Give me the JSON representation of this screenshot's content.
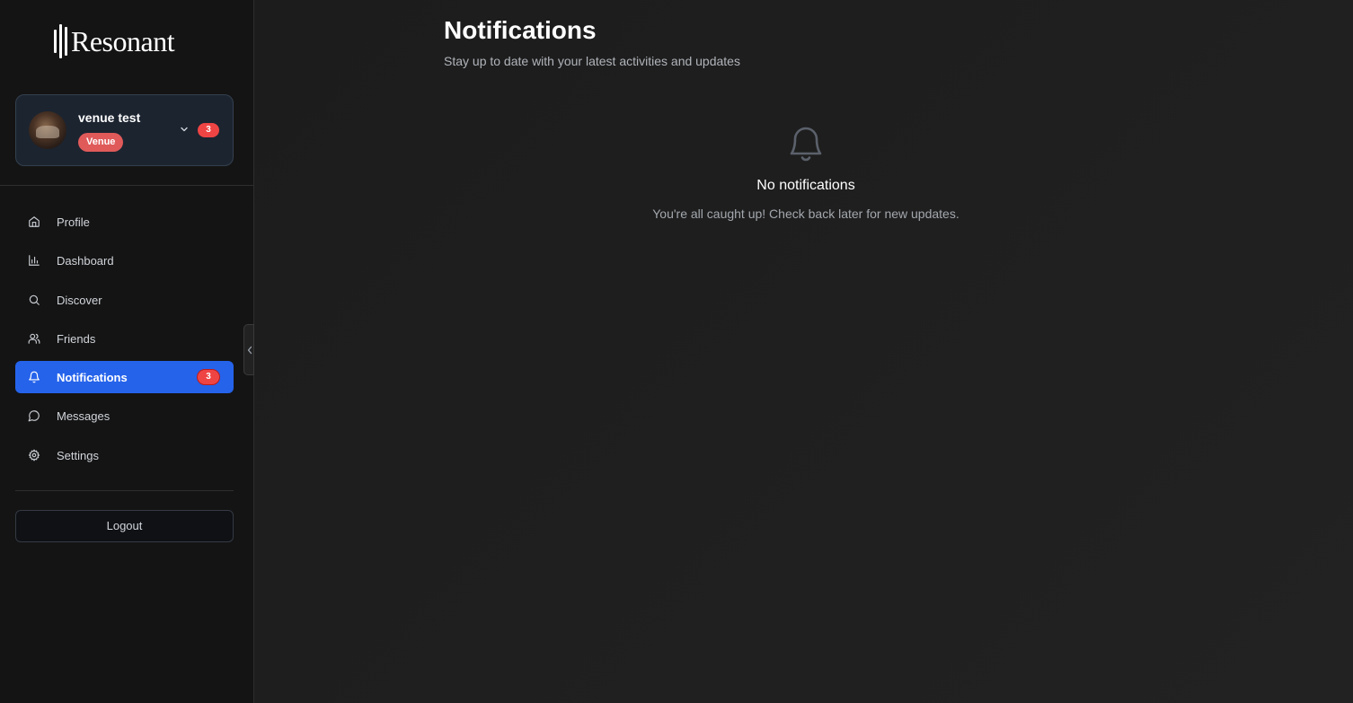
{
  "brand": {
    "name": "Resonant"
  },
  "user": {
    "name": "venue test",
    "role": "Venue",
    "notification_count": "3"
  },
  "nav": {
    "items": [
      {
        "label": "Profile",
        "icon": "home-icon"
      },
      {
        "label": "Dashboard",
        "icon": "bar-chart-icon"
      },
      {
        "label": "Discover",
        "icon": "search-icon"
      },
      {
        "label": "Friends",
        "icon": "users-icon"
      },
      {
        "label": "Notifications",
        "icon": "bell-icon",
        "active": true,
        "badge": "3"
      },
      {
        "label": "Messages",
        "icon": "message-circle-icon"
      },
      {
        "label": "Settings",
        "icon": "gear-icon"
      }
    ],
    "logout_label": "Logout"
  },
  "page": {
    "title": "Notifications",
    "subtitle": "Stay up to date with your latest activities and updates"
  },
  "empty_state": {
    "title": "No notifications",
    "text": "You're all caught up! Check back later for new updates."
  },
  "colors": {
    "accent": "#2563eb",
    "badge": "#ef4444",
    "role_badge": "#e05a5a",
    "sidebar_bg": "#141414",
    "main_bg": "#1c1c1c"
  }
}
